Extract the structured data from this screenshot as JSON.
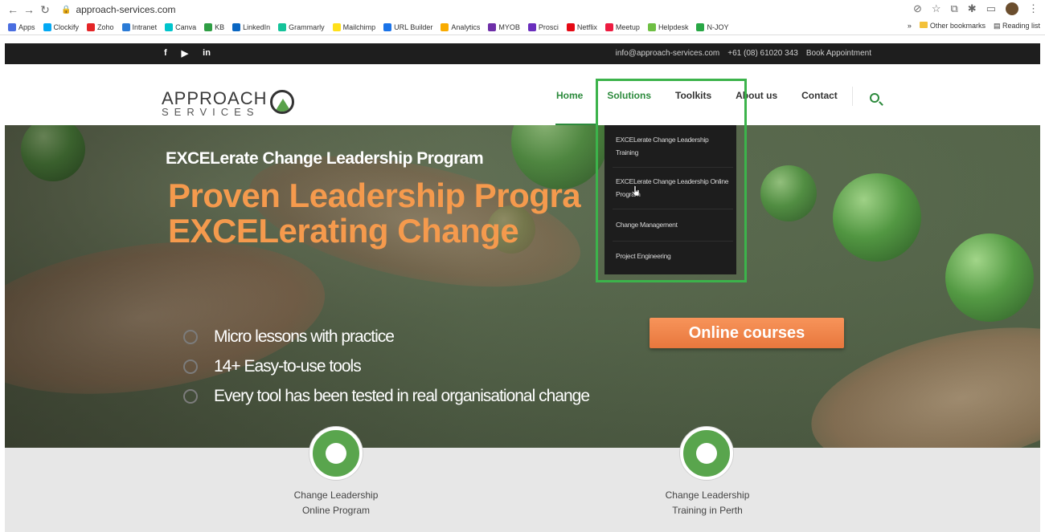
{
  "browser": {
    "url": "approach-services.com",
    "bookmarks": [
      {
        "label": "Apps",
        "color": "#4a6ee0"
      },
      {
        "label": "Clockify",
        "color": "#03a9f4"
      },
      {
        "label": "Zoho",
        "color": "#e42527"
      },
      {
        "label": "Intranet",
        "color": "#2b7bd6"
      },
      {
        "label": "Canva",
        "color": "#00c4cc"
      },
      {
        "label": "KB",
        "color": "#2f9e44"
      },
      {
        "label": "LinkedIn",
        "color": "#0a66c2"
      },
      {
        "label": "Grammarly",
        "color": "#15c39a"
      },
      {
        "label": "Mailchimp",
        "color": "#ffe01b"
      },
      {
        "label": "URL Builder",
        "color": "#1a73e8"
      },
      {
        "label": "Analytics",
        "color": "#f9ab00"
      },
      {
        "label": "MYOB",
        "color": "#6e2fa8"
      },
      {
        "label": "Prosci",
        "color": "#6a2ebd"
      },
      {
        "label": "Netflix",
        "color": "#e50914"
      },
      {
        "label": "Meetup",
        "color": "#ed1c40"
      },
      {
        "label": "Helpdesk",
        "color": "#6fbf44"
      },
      {
        "label": "N-JOY",
        "color": "#28a745"
      }
    ],
    "overflow_label": "»",
    "other_bookmarks": "Other bookmarks",
    "reading_list": "Reading list"
  },
  "topbar": {
    "social": [
      "f",
      "▶",
      "in"
    ],
    "email": "info@approach-services.com",
    "phone": "+61 (08) 61020 343",
    "appointment": "Book Appointment"
  },
  "header": {
    "logo_main": "APPROACH",
    "logo_sub": "SERVICES",
    "nav": [
      "Home",
      "Solutions",
      "Toolkits",
      "About us",
      "Contact"
    ]
  },
  "dropdown": {
    "items": [
      "EXCELerate Change Leadership Training",
      "EXCELerate Change Leadership Online Program",
      "Change Management",
      "Project Engineering"
    ]
  },
  "hero": {
    "kicker": "EXCELerate Change Leadership Program",
    "title_line1": "Proven Leadership Progra",
    "title_line2": "EXCELerating Change",
    "bullets": [
      "Micro lessons with practice",
      "14+ Easy-to-use tools",
      "Every tool has been tested in real organisational change"
    ],
    "cta": "Online courses"
  },
  "features": [
    {
      "line1": "Change Leadership",
      "line2": "Online Program",
      "icon": "globe-icon"
    },
    {
      "line1": "Change Leadership",
      "line2": "Training in Perth",
      "icon": "group-icon"
    }
  ],
  "colors": {
    "brand_green": "#2c8a3c",
    "accent_orange": "#f59a4d",
    "highlight": "#3cb34b"
  }
}
